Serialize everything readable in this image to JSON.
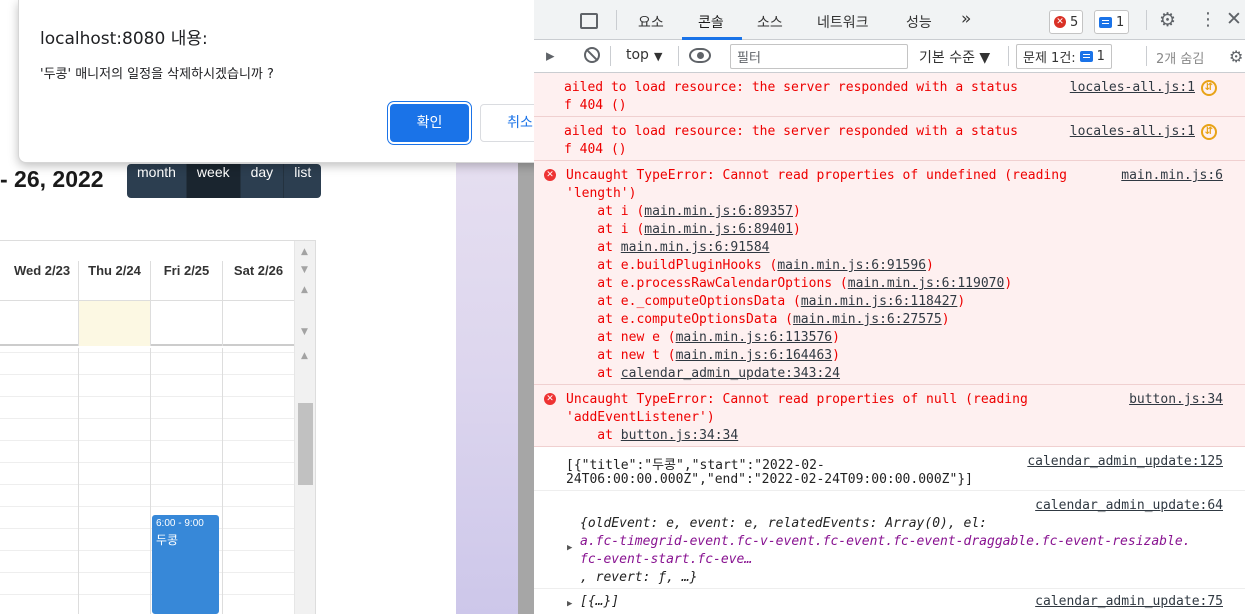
{
  "calendar": {
    "title": "- 26, 2022",
    "views": [
      "month",
      "week",
      "day",
      "list"
    ],
    "active_view": "week",
    "days": [
      "Wed 2/23",
      "Thu 2/24",
      "Fri 2/25",
      "Sat 2/26"
    ],
    "event": {
      "time": "6:00 - 9:00",
      "title": "두콩"
    }
  },
  "alert": {
    "origin": "localhost:8080 내용:",
    "message": "'두콩' 매니저의 일정을 삭제하시겠습니까 ?",
    "ok_label": "확인",
    "cancel_label": "취소"
  },
  "devtools": {
    "tabs": [
      "요소",
      "콘솔",
      "소스",
      "네트워크",
      "성능"
    ],
    "active_tab": "콘솔",
    "more_tabs": "»",
    "error_count": "5",
    "message_count": "1",
    "toolbar": {
      "context": "top",
      "filter_placeholder": "필터",
      "levels": "기본 수준 ▼",
      "issues_label": "문제 1건:",
      "issues_count": "1",
      "hidden_label": "2개 숨김"
    },
    "console": {
      "err1_l1": "ailed to load resource: the server responded with a status",
      "err1_l2": "f 404 ()",
      "err1_src": "locales-all.js:1",
      "err2_l1": "ailed to load resource: the server responded with a status",
      "err2_l2": "f 404 ()",
      "err2_src": "locales-all.js:1",
      "err3_l1": "Uncaught TypeError: Cannot read properties of undefined (reading",
      "err3_l2": "'length')",
      "err3_src": "main.min.js:6",
      "stack": [
        {
          "pre": "    at i (",
          "link": "main.min.js:6:89357",
          "post": ")"
        },
        {
          "pre": "    at i (",
          "link": "main.min.js:6:89401",
          "post": ")"
        },
        {
          "pre": "    at ",
          "link": "main.min.js:6:91584",
          "post": ""
        },
        {
          "pre": "    at e.buildPluginHooks (",
          "link": "main.min.js:6:91596",
          "post": ")"
        },
        {
          "pre": "    at e.processRawCalendarOptions (",
          "link": "main.min.js:6:119070",
          "post": ")"
        },
        {
          "pre": "    at e._computeOptionsData (",
          "link": "main.min.js:6:118427",
          "post": ")"
        },
        {
          "pre": "    at e.computeOptionsData (",
          "link": "main.min.js:6:27575",
          "post": ")"
        },
        {
          "pre": "    at new e (",
          "link": "main.min.js:6:113576",
          "post": ")"
        },
        {
          "pre": "    at new t (",
          "link": "main.min.js:6:164463",
          "post": ")"
        },
        {
          "pre": "    at ",
          "link": "calendar_admin_update:343:24",
          "post": ""
        }
      ],
      "err4_l1": "Uncaught TypeError: Cannot read properties of null (reading",
      "err4_l2": "'addEventListener')",
      "err4_stack_pre": "    at ",
      "err4_stack_link": "button.js:34:34",
      "err4_src": "button.js:34",
      "log1_l1": "[{\"title\":\"두콩\",\"start\":\"2022-02-",
      "log1_l2": "24T06:00:00.000Z\",\"end\":\"2022-02-24T09:00:00.000Z\"}]",
      "log1_src": "calendar_admin_update:125",
      "log2_src": "calendar_admin_update:64",
      "log2_l1": "{oldEvent: e, event: e, relatedEvents: Array(0), el:",
      "log2_l2": "a.fc-timegrid-event.fc-v-event.fc-event.fc-event-draggable.fc-event-resizable.",
      "log2_l3": "fc-event-start.fc-eve…",
      "log2_l4": ", revert: ƒ, …}",
      "log3_l1": "[{…}]",
      "log3_src": "calendar_admin_update:75"
    }
  }
}
